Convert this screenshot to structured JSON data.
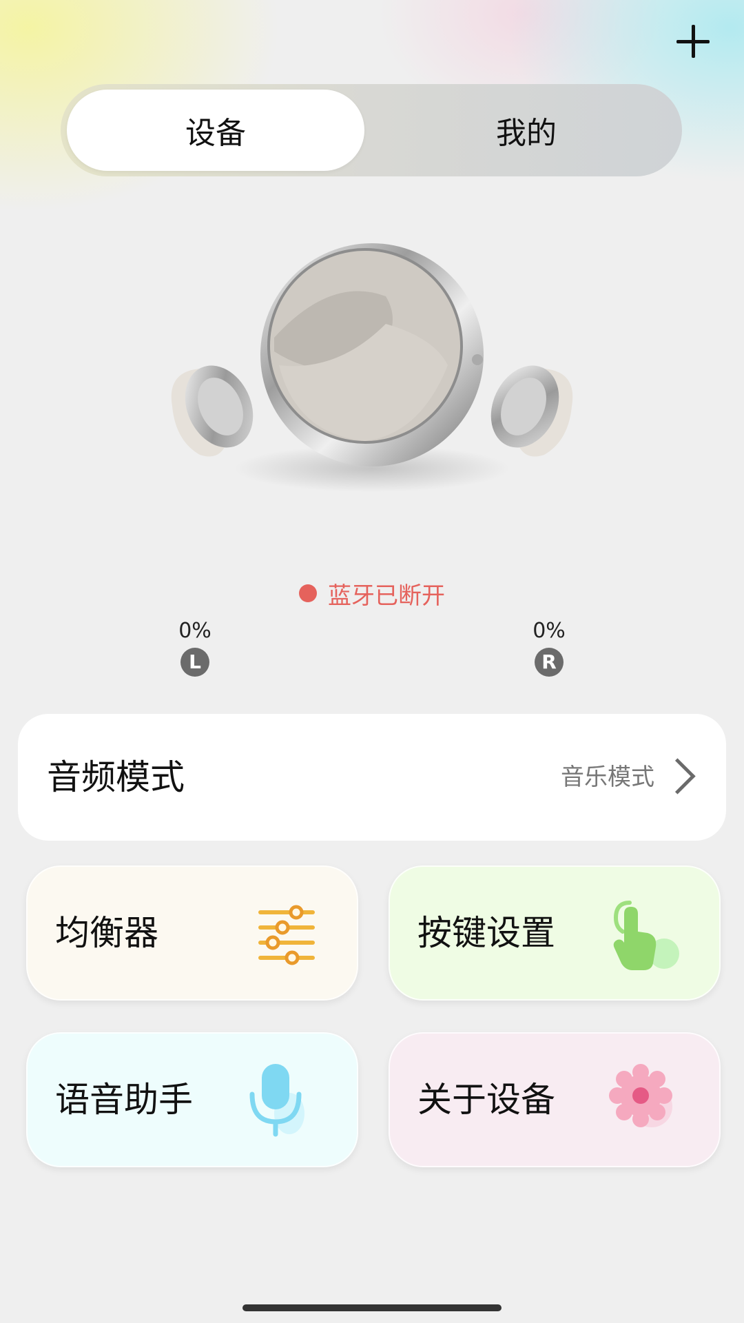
{
  "header": {
    "add_icon": "plus-icon"
  },
  "tabs": [
    {
      "label": "设备",
      "active": true
    },
    {
      "label": "我的",
      "active": false
    }
  ],
  "status": {
    "text": "蓝牙已断开",
    "color": "#e5625c"
  },
  "battery": {
    "left": {
      "value": "0%",
      "badge": "L"
    },
    "right": {
      "value": "0%",
      "badge": "R"
    }
  },
  "audio_mode": {
    "label": "音频模式",
    "value": "音乐模式",
    "icon": "chevron-right-icon"
  },
  "tiles": [
    {
      "label": "均衡器",
      "icon": "equalizer-icon",
      "background": "#fcf9f1"
    },
    {
      "label": "按键设置",
      "icon": "touch-hand-icon",
      "background": "#effce4"
    },
    {
      "label": "语音助手",
      "icon": "microphone-icon",
      "background": "#eefdfd"
    },
    {
      "label": "关于设备",
      "icon": "gear-icon",
      "background": "#f8ecf2"
    }
  ]
}
